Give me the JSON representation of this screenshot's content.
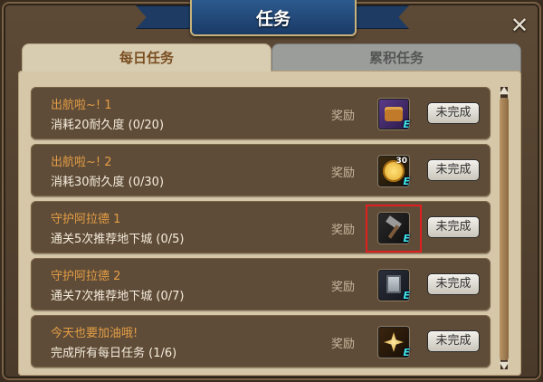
{
  "window": {
    "title": "任务",
    "close_glyph": "✕"
  },
  "tabs": [
    {
      "label": "每日任务",
      "active": true
    },
    {
      "label": "累积任务",
      "active": false
    }
  ],
  "tasks": [
    {
      "title": "出航啦~! 1",
      "desc": "消耗20耐久度 (0/20)",
      "reward_label": "奖励",
      "reward_icon": "treasure-chest-icon",
      "status_button": "未完成"
    },
    {
      "title": "出航啦~! 2",
      "desc": "消耗30耐久度 (0/30)",
      "reward_label": "奖励",
      "reward_icon": "gold-coin-icon",
      "reward_badge": "30",
      "status_button": "未完成"
    },
    {
      "title": "守护阿拉德 1",
      "desc": "通关5次推荐地下城 (0/5)",
      "reward_label": "奖励",
      "reward_icon": "hammer-icon",
      "status_button": "未完成"
    },
    {
      "title": "守护阿拉德 2",
      "desc": "通关7次推荐地下城 (0/7)",
      "reward_label": "奖励",
      "reward_icon": "stone-slab-icon",
      "status_button": "未完成"
    },
    {
      "title": "今天也要加油哦!",
      "desc": "完成所有每日任务 (1/6)",
      "reward_label": "奖励",
      "reward_icon": "gold-treasure-icon",
      "status_button": "未完成"
    }
  ],
  "reward_tag": "E",
  "colors": {
    "task_title": "#e39d45",
    "task_desc": "#f4ecdc",
    "highlight_border": "#e02020",
    "banner": "#2c5a8e"
  }
}
